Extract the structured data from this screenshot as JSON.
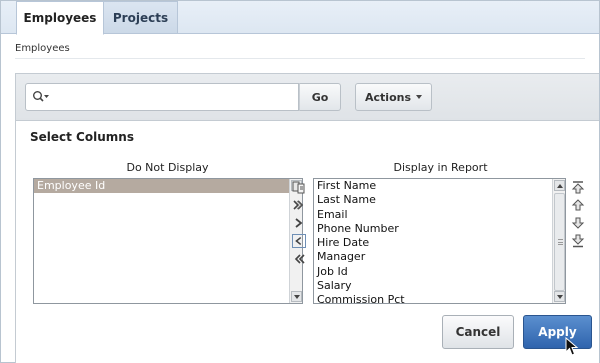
{
  "tabs": [
    {
      "label": "Employees",
      "active": true
    },
    {
      "label": "Projects",
      "active": false
    }
  ],
  "breadcrumb": "Employees",
  "toolbar": {
    "search_icon": "search-icon",
    "search_value": "",
    "go_label": "Go",
    "actions_label": "Actions"
  },
  "panel": {
    "title": "Select Columns",
    "do_not_display": {
      "heading": "Do Not Display",
      "items": [
        "Employee Id"
      ],
      "selected": "Employee Id"
    },
    "display_in_report": {
      "heading": "Display in Report",
      "items": [
        "First Name",
        "Last Name",
        "Email",
        "Phone Number",
        "Hire Date",
        "Manager",
        "Job Id",
        "Salary",
        "Commission Pct"
      ]
    },
    "shuttle_icons": [
      "reset-icon",
      "move-all-right-icon",
      "move-right-icon",
      "move-left-icon",
      "move-all-left-icon"
    ],
    "order_icons": [
      "move-top-icon",
      "move-up-icon",
      "move-down-icon",
      "move-bottom-icon"
    ],
    "cancel_label": "Cancel",
    "apply_label": "Apply"
  },
  "colors": {
    "tab_bar": "#dde7f2",
    "selected_item": "#b5aaa0",
    "apply_button": "#3a6fb8"
  }
}
